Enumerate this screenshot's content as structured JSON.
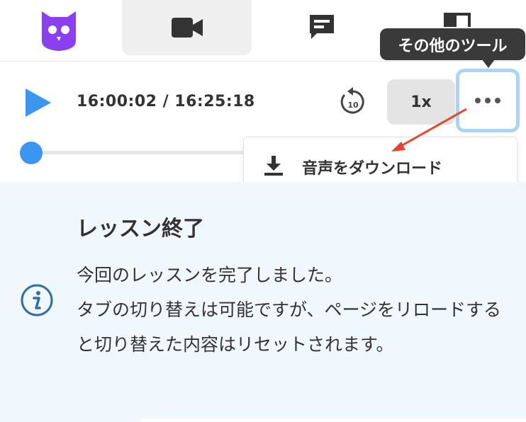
{
  "nav": {
    "icons": {
      "logo": "owl-logo",
      "video": "video-camera-icon",
      "chat": "chat-bubble-icon",
      "layout": "layout-icon"
    }
  },
  "player": {
    "time": "16:00:02 / 16:25:18",
    "replay_seconds": "10",
    "speed": "1x",
    "progress_fraction": 0.0
  },
  "tooltip": {
    "text": "その他のツール"
  },
  "menu": {
    "items": [
      {
        "label": "音声をダウンロード",
        "icon": "download-icon"
      }
    ]
  },
  "notice": {
    "title": "レッスン終了",
    "lines": [
      "今回のレッスンを完了しました。",
      "タブの切り替えは可能ですが、ページをリロードすると切り替えた内容はリセットされます。"
    ]
  },
  "colors": {
    "accent": "#3b96f2",
    "logo": "#8a3ff0",
    "notice_bg": "#f0f7fd",
    "tooltip_bg": "#3a3a3a",
    "annotation": "#e8432e"
  }
}
